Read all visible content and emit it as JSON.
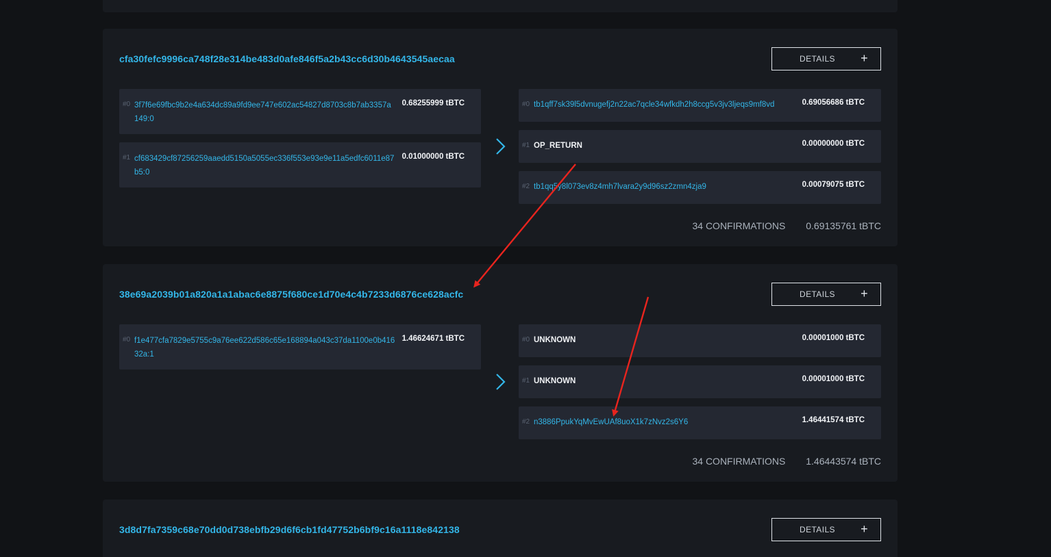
{
  "details_label": "DETAILS",
  "plus_glyph": "+",
  "icons": {
    "chevron": "chevron-right-icon",
    "plus": "plus-icon",
    "annotation": "red-annotation-arrow-icon"
  },
  "colors": {
    "accent": "#33b6e8",
    "background": "#111316",
    "card": "#181b20",
    "row": "#242832",
    "annotation": "#e8241e"
  },
  "transactions": [
    {
      "txid": "cfa30fefc9996ca748f28e314be483d0afe846f5a2b43cc6d30b4643545aecaa",
      "inputs": [
        {
          "index": "#0",
          "address": "3f7f6e69fbc9b2e4a634dc89a9fd9ee747e602ac54827d8703c8b7ab3357a149:0",
          "amount": "0.68255999 tBTC"
        },
        {
          "index": "#1",
          "address": "cf683429cf87256259aaedd5150a5055ec336f553e93e9e11a5edfc6011e87b5:0",
          "amount": "0.01000000 tBTC"
        }
      ],
      "outputs": [
        {
          "index": "#0",
          "address": "tb1qff7sk39l5dvnugefj2n22ac7qcle34wfkdh2h8ccg5v3jv3ljeqs9mf8vd",
          "amount": "0.69056686 tBTC"
        },
        {
          "index": "#1",
          "address": "OP_RETURN",
          "amount": "0.00000000 tBTC"
        },
        {
          "index": "#2",
          "address": "tb1qq5y8l073ev8z4mh7lvara2y9d96sz2zmn4zja9",
          "amount": "0.00079075 tBTC"
        }
      ],
      "confirmations": "34 CONFIRMATIONS",
      "total": "0.69135761 tBTC"
    },
    {
      "txid": "38e69a2039b01a820a1a1abac6e8875f680ce1d70e4c4b7233d6876ce628acfc",
      "inputs": [
        {
          "index": "#0",
          "address": "f1e477cfa7829e5755c9a76ee622d586c65e168894a043c37da1100e0b41632a:1",
          "amount": "1.46624671 tBTC"
        }
      ],
      "outputs": [
        {
          "index": "#0",
          "address": "UNKNOWN",
          "amount": "0.00001000 tBTC"
        },
        {
          "index": "#1",
          "address": "UNKNOWN",
          "amount": "0.00001000 tBTC"
        },
        {
          "index": "#2",
          "address": "n3886PpukYqMvEwUAf8uoX1k7zNvz2s6Y6",
          "amount": "1.46441574 tBTC"
        }
      ],
      "confirmations": "34 CONFIRMATIONS",
      "total": "1.46443574 tBTC"
    },
    {
      "txid": "3d8d7fa7359c68e70dd0d738ebfb29d6f6cb1fd47752b6bf9c16a1118e842138"
    }
  ]
}
